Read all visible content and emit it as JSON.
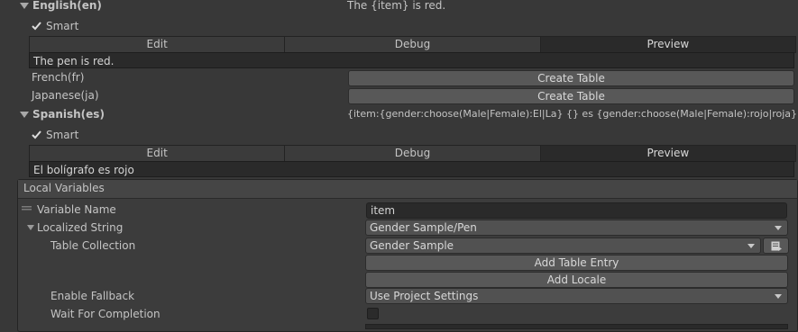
{
  "english": {
    "locale": "English(en)",
    "entry": "The {item} is red.",
    "smart_label": "Smart",
    "tabs": [
      "Edit",
      "Debug",
      "Preview"
    ],
    "preview": "The pen is red."
  },
  "french": {
    "locale": "French(fr)",
    "button": "Create Table"
  },
  "japanese": {
    "locale": "Japanese(ja)",
    "button": "Create Table"
  },
  "spanish": {
    "locale": "Spanish(es)",
    "entry": "{item:{gender:choose(Male|Female):El|La} {} es {gender:choose(Male|Female):rojo|roja} }",
    "smart_label": "Smart",
    "tabs": [
      "Edit",
      "Debug",
      "Preview"
    ],
    "preview": "El bolígrafo es rojo"
  },
  "local_variables": {
    "title": "Local Variables",
    "variable_name_label": "Variable Name",
    "variable_name_value": "item",
    "localized_string_label": "Localized String",
    "localized_string_value": "Gender Sample/Pen",
    "table_collection_label": "Table Collection",
    "table_collection_value": "Gender Sample",
    "add_table_entry": "Add Table Entry",
    "add_locale": "Add Locale",
    "enable_fallback_label": "Enable Fallback",
    "enable_fallback_value": "Use Project Settings",
    "wait_label": "Wait For Completion"
  }
}
